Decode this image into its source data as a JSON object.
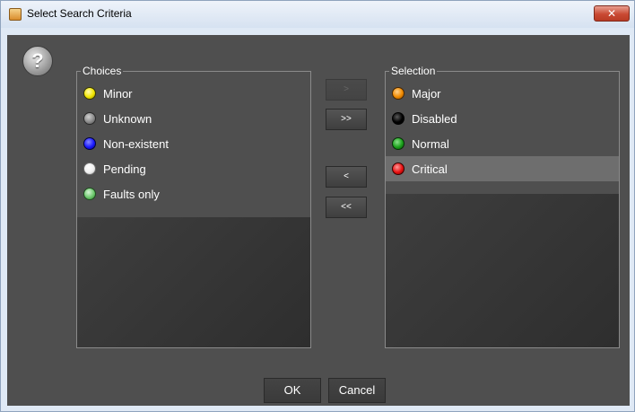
{
  "window": {
    "title": "Select Search Criteria",
    "close_label": "✕"
  },
  "help": {
    "glyph": "?"
  },
  "choices": {
    "legend": "Choices",
    "items": [
      {
        "label": "Minor",
        "color": "#f2e600"
      },
      {
        "label": "Unknown",
        "color": "#8a8a8a"
      },
      {
        "label": "Non-existent",
        "color": "#1a1aff"
      },
      {
        "label": "Pending",
        "color": "#ffffff"
      },
      {
        "label": "Faults only",
        "color": "#6ec96e"
      }
    ]
  },
  "selection": {
    "legend": "Selection",
    "items": [
      {
        "label": "Major",
        "color": "#f08a00",
        "selected": false
      },
      {
        "label": "Disabled",
        "color": "#000000",
        "selected": false
      },
      {
        "label": "Normal",
        "color": "#1aa01a",
        "selected": false
      },
      {
        "label": "Critical",
        "color": "#e81010",
        "selected": true
      }
    ]
  },
  "transfer_buttons": {
    "add": ">",
    "add_all": ">>",
    "remove": "<",
    "remove_all": "<<"
  },
  "footer": {
    "ok": "OK",
    "cancel": "Cancel"
  }
}
